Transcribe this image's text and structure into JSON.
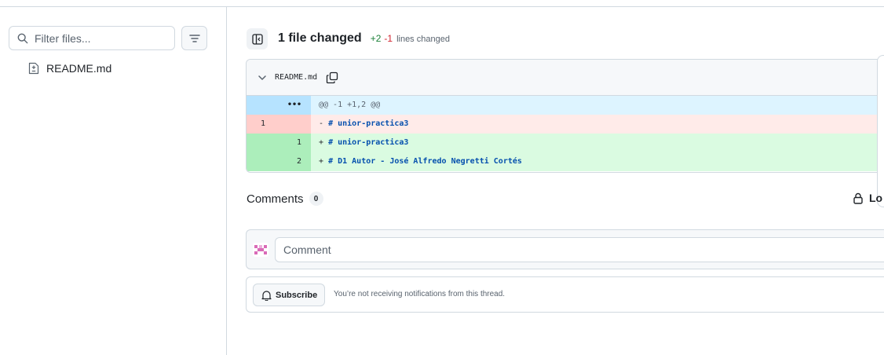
{
  "sidebar": {
    "filter_placeholder": "Filter files...",
    "files": [
      {
        "name": "README.md",
        "icon": "file-diff-icon"
      }
    ]
  },
  "header": {
    "title": "1 file changed",
    "additions": "+2",
    "deletions": "-1",
    "lines_label": "lines changed"
  },
  "diff": {
    "file_name": "README.md",
    "hunk": {
      "marker": "•••",
      "text": "@@ -1 +1,2 @@"
    },
    "lines": [
      {
        "type": "del",
        "old": "1",
        "new": "",
        "sign": "-",
        "code": "# unior-practica3"
      },
      {
        "type": "add",
        "old": "",
        "new": "1",
        "sign": "+",
        "code": "# unior-practica3"
      },
      {
        "type": "add",
        "old": "",
        "new": "2",
        "sign": "+",
        "code": "# D1 Autor - José Alfredo Negretti Cortés"
      }
    ]
  },
  "comments": {
    "title": "Comments",
    "count": "0",
    "lock_label": "Lo",
    "input_placeholder": "Comment"
  },
  "subscribe": {
    "button_label": "Subscribe",
    "note": "You’re not receiving notifications from this thread."
  },
  "colors": {
    "addition": "#1a7f37",
    "deletion": "#d1242f",
    "code_text": "#0550ae"
  }
}
